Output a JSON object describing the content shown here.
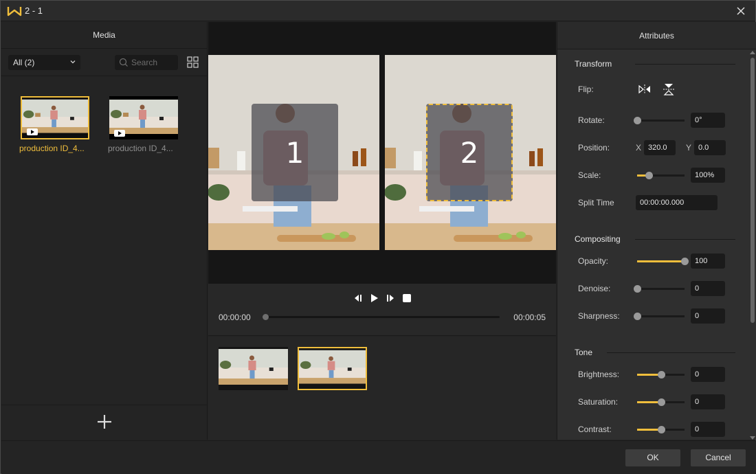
{
  "window": {
    "title": "2 - 1",
    "accent_color": "#f0be3c"
  },
  "media": {
    "header": "Media",
    "filter_value": "All (2)",
    "search_placeholder": "Search",
    "items": [
      {
        "name": "production ID_4...",
        "selected": true
      },
      {
        "name": "production ID_4...",
        "selected": false
      }
    ]
  },
  "preview": {
    "boxes": [
      {
        "label": "1",
        "selected": false
      },
      {
        "label": "2",
        "selected": true
      }
    ]
  },
  "playback": {
    "current_time": "00:00:00",
    "end_time": "00:00:05",
    "progress": 0
  },
  "timeline": {
    "clips": [
      {
        "selected": false
      },
      {
        "selected": true
      }
    ]
  },
  "attributes": {
    "header": "Attributes",
    "transform": {
      "title": "Transform",
      "flip_label": "Flip:",
      "rotate_label": "Rotate:",
      "rotate_value": "0°",
      "rotate_fraction": 0,
      "position_label": "Position:",
      "x_label": "X",
      "x_value": "320.0",
      "y_label": "Y",
      "y_value": "0.0",
      "scale_label": "Scale:",
      "scale_value": "100%",
      "scale_fraction": 0.25,
      "split_time_label": "Split Time",
      "split_time_value": "00:00:00.000"
    },
    "compositing": {
      "title": "Compositing",
      "opacity_label": "Opacity:",
      "opacity_value": "100",
      "opacity_fraction": 1.0,
      "denoise_label": "Denoise:",
      "denoise_value": "0",
      "denoise_fraction": 0,
      "sharpness_label": "Sharpness:",
      "sharpness_value": "0",
      "sharpness_fraction": 0
    },
    "tone": {
      "title": "Tone",
      "brightness_label": "Brightness:",
      "brightness_value": "0",
      "brightness_fraction": 0.5,
      "saturation_label": "Saturation:",
      "saturation_value": "0",
      "saturation_fraction": 0.5,
      "contrast_label": "Contrast:",
      "contrast_value": "0",
      "contrast_fraction": 0.5
    }
  },
  "footer": {
    "ok_label": "OK",
    "cancel_label": "Cancel"
  }
}
